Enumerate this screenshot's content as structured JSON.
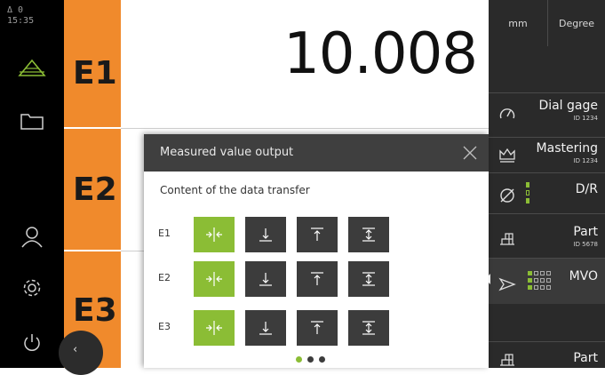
{
  "status": {
    "delta": "Δ 0",
    "time": "15:35"
  },
  "axes": [
    {
      "label": "E1",
      "value": "10.008"
    },
    {
      "label": "E2"
    },
    {
      "label": "E3"
    }
  ],
  "units": {
    "length": "mm",
    "angle": "Degree"
  },
  "right_panel": [
    {
      "title": "Dial gage",
      "sub": "ID 1234",
      "icon": "gauge-icon"
    },
    {
      "title": "Mastering",
      "sub": "ID 1234",
      "icon": "crown-icon"
    },
    {
      "title": "D/R",
      "sub": "",
      "icon": "diameter-icon"
    },
    {
      "title": "Part",
      "sub": "ID 5678",
      "icon": "part-icon"
    },
    {
      "title": "MVO",
      "sub": "",
      "icon": "send-icon"
    },
    {
      "title": "Part",
      "sub": "",
      "icon": "part-icon"
    }
  ],
  "dialog": {
    "title": "Measured value output",
    "subtitle": "Content of the data transfer",
    "rows": [
      {
        "label": "E1",
        "selected_index": 0
      },
      {
        "label": "E2",
        "selected_index": 0
      },
      {
        "label": "E3",
        "selected_index": 0
      }
    ],
    "option_icons": [
      "actual-value-icon",
      "minimum-icon",
      "maximum-icon",
      "range-icon"
    ],
    "page_dots": {
      "count": 3,
      "active": 0
    }
  },
  "colors": {
    "accent_orange": "#f08a2c",
    "accent_green": "#8bbd35",
    "panel_dark": "#2a2a2a",
    "dialog_header": "#3f3f3f"
  }
}
